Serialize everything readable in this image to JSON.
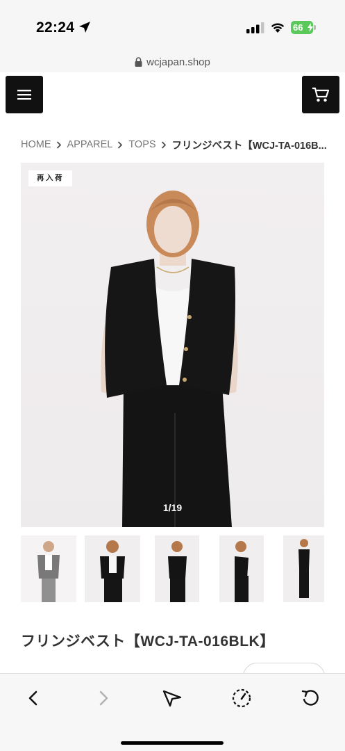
{
  "status_bar": {
    "time": "22:24",
    "battery": "66",
    "icons": [
      "location-arrow-icon",
      "signal-icon",
      "wifi-icon",
      "battery-icon"
    ]
  },
  "browser": {
    "url": "wcjapan.shop"
  },
  "header": {
    "menu_icon": "hamburger-menu-icon",
    "cart_icon": "cart-icon"
  },
  "breadcrumb": {
    "items": [
      "HOME",
      "APPAREL",
      "TOPS"
    ],
    "current": "フリンジベスト【WCJ-TA-016B..."
  },
  "gallery": {
    "badge": "再入荷",
    "counter": "1/19",
    "thumbnail_count": 5
  },
  "product": {
    "title": "フリンジベスト【WCJ-TA-016BLK】"
  },
  "toolbar": {
    "buttons": [
      "back-icon",
      "forward-icon",
      "share-icon",
      "speed-icon",
      "reload-icon"
    ]
  },
  "colors": {
    "header_buttons": "#111111",
    "battery": "#5ac85a",
    "image_bg": "#f0eeef",
    "vest": "#161616"
  }
}
